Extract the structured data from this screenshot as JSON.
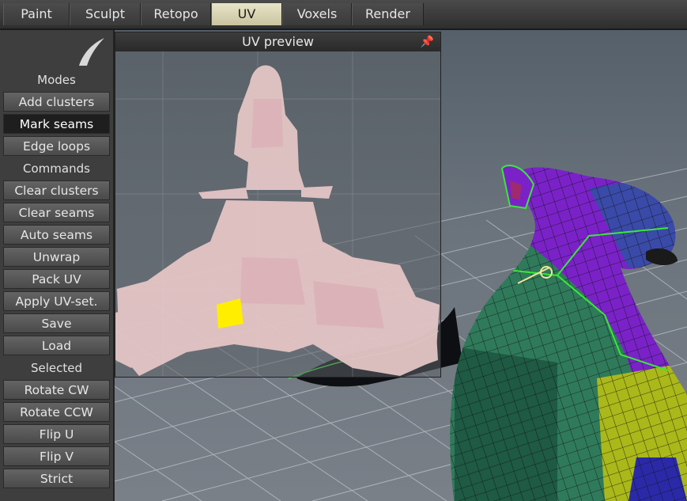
{
  "tabs": [
    {
      "label": "Paint",
      "active": false
    },
    {
      "label": "Sculpt",
      "active": false
    },
    {
      "label": "Retopo",
      "active": false
    },
    {
      "label": "UV",
      "active": true
    },
    {
      "label": "Voxels",
      "active": false
    },
    {
      "label": "Render",
      "active": false
    }
  ],
  "left_panel": {
    "modes_label": "Modes",
    "modes": [
      {
        "label": "Add clusters",
        "active": false
      },
      {
        "label": "Mark seams",
        "active": true
      },
      {
        "label": "Edge loops",
        "active": false
      }
    ],
    "commands_label": "Commands",
    "commands": [
      {
        "label": "Clear clusters"
      },
      {
        "label": "Clear seams"
      },
      {
        "label": "Auto seams"
      },
      {
        "label": "Unwrap"
      },
      {
        "label": "Pack UV"
      },
      {
        "label": "Apply UV-set."
      },
      {
        "label": "Save"
      },
      {
        "label": "Load"
      }
    ],
    "selected_label": "Selected",
    "selected": [
      {
        "label": "Rotate CW"
      },
      {
        "label": "Rotate CCW"
      },
      {
        "label": "Flip U"
      },
      {
        "label": "Flip V"
      },
      {
        "label": "Strict"
      }
    ]
  },
  "uv_preview": {
    "title": "UV preview",
    "pin_icon": "pin-icon"
  },
  "colors": {
    "active_tab": "#d8d3b4",
    "active_mode": "#1e1e1e",
    "uv_island": "#e8c8c8",
    "uv_selected": "#ffee00",
    "cluster_purple": "#7a22c8",
    "cluster_teal": "#2f7a5a",
    "cluster_blue": "#3a4aa8",
    "cluster_yellow": "#aab81a",
    "seam": "#38e838"
  }
}
